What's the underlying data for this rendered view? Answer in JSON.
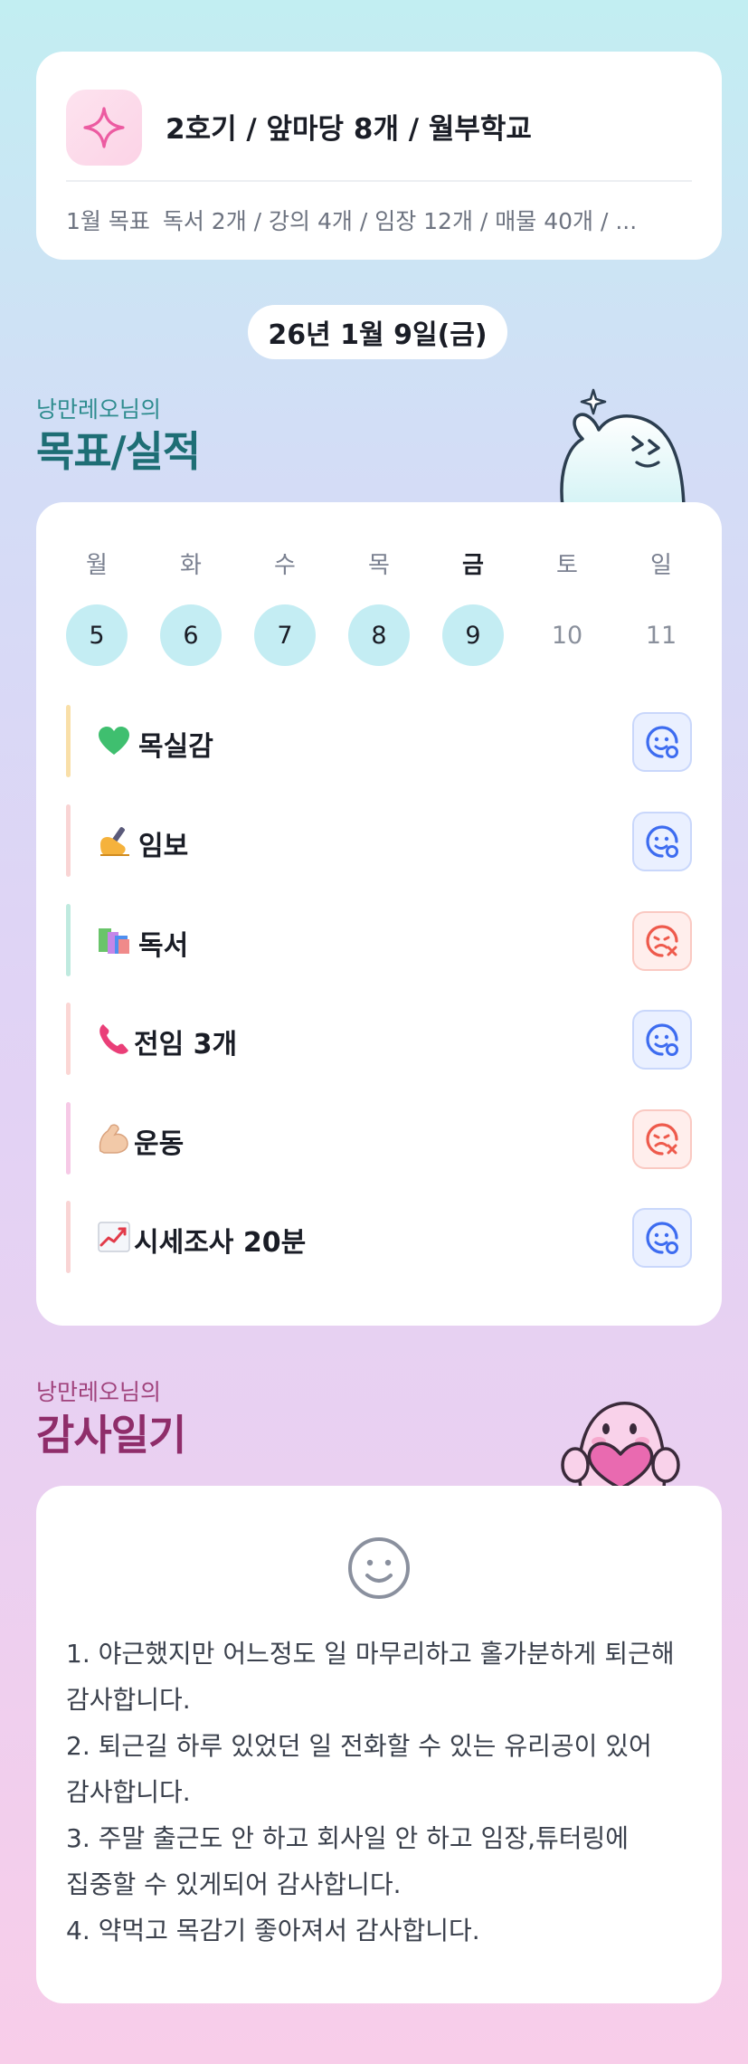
{
  "header": {
    "title": "2호기 / 앞마당 8개 / 월부학교",
    "goal_prefix": "1월 목표",
    "goal_text": "독서 2개 / 강의 4개 / 임장 12개 / 매물 40개 / ..."
  },
  "date_label": "26년 1월 9일(금)",
  "goals_section": {
    "owner": "낭만레오님의",
    "title": "목표/실적"
  },
  "week": {
    "days": [
      {
        "name": "월",
        "num": "5",
        "done": true,
        "current": false
      },
      {
        "name": "화",
        "num": "6",
        "done": true,
        "current": false
      },
      {
        "name": "수",
        "num": "7",
        "done": true,
        "current": false
      },
      {
        "name": "목",
        "num": "8",
        "done": true,
        "current": false
      },
      {
        "name": "금",
        "num": "9",
        "done": true,
        "current": true
      },
      {
        "name": "토",
        "num": "10",
        "done": false,
        "current": false
      },
      {
        "name": "일",
        "num": "11",
        "done": false,
        "current": false
      }
    ]
  },
  "goals": [
    {
      "label": "목실감",
      "icon": "green-heart-icon",
      "bar_color": "#f9dfa8",
      "status": "success"
    },
    {
      "label": "임보",
      "icon": "writing-hand-icon",
      "bar_color": "#f9d4d4",
      "status": "success"
    },
    {
      "label": "독서",
      "icon": "books-icon",
      "bar_color": "#bfeadf",
      "status": "fail"
    },
    {
      "label": "전임 3개",
      "icon": "telephone-receiver-icon",
      "bar_color": "#fbd6d4",
      "status": "success"
    },
    {
      "label": "운동",
      "icon": "flexed-biceps-icon",
      "bar_color": "#f6c9e6",
      "status": "fail"
    },
    {
      "label": "시세조사 20분",
      "icon": "chart-increasing-icon",
      "bar_color": "#f9d4d4",
      "status": "success"
    }
  ],
  "thanks_section": {
    "owner": "낭만레오님의",
    "title": "감사일기"
  },
  "thanks": {
    "icon": "smile-face-icon",
    "lines": [
      "1. 야근했지만 어느정도 일 마무리하고 홀가분하게 퇴근해 감사합니다.",
      "2. 퇴근길 하루 있었던 일 전화할 수 있는 유리공이 있어 감사합니다.",
      "3. 주말 출근도 안 하고 회사일 안 하고 임장,튜터링에 집중할 수 있게되어 감사합니다.",
      "4. 약먹고 목감기 좋아져서 감사합니다."
    ]
  },
  "colors": {
    "success": "#3d6cf0",
    "fail": "#ee5a4c",
    "day_done_bg": "#c4edf3",
    "goals_title": "#1e6e75",
    "thanks_title": "#8f2d6a"
  }
}
